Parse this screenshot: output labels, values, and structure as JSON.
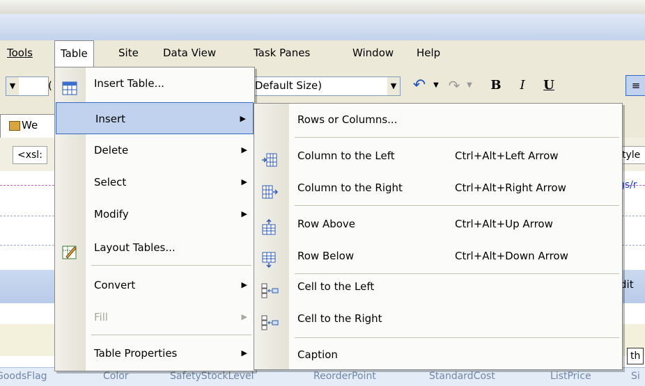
{
  "menubar": {
    "items": [
      {
        "label": "Tools",
        "mnemonic_index": 0
      },
      {
        "label": "Table",
        "mnemonic_index": 1
      },
      {
        "label": "Site",
        "mnemonic_index": 0
      },
      {
        "label": "Data View",
        "mnemonic_index": 0
      },
      {
        "label": "Task Panes",
        "mnemonic_index": 3
      },
      {
        "label": "Window",
        "mnemonic_index": 0
      },
      {
        "label": "Help",
        "mnemonic_index": 0
      }
    ]
  },
  "toolbar": {
    "font_size_value": "(Default Size)",
    "left_dropdown_fragment": "(",
    "bold_label": "B",
    "italic_label": "I",
    "underline_label": "U"
  },
  "background": {
    "tab_fragment": "We",
    "path_fragment": "<xsl:",
    "right_fragment_1": "tyle",
    "right_fragment_2": "gs/r",
    "right_fragment_3": "dit",
    "right_fragment_4": "th",
    "columns": [
      "GoodsFlag",
      "Color",
      "SafetyStockLevel",
      "ReorderPoint",
      "StandardCost",
      "ListPrice",
      "Si"
    ]
  },
  "table_menu": {
    "items": [
      {
        "label": "Insert Table...",
        "icon": "insert-table-icon",
        "submenu": false
      },
      {
        "label": "Insert",
        "submenu": true,
        "highlighted": true
      },
      {
        "label": "Delete",
        "submenu": true
      },
      {
        "label": "Select",
        "submenu": true
      },
      {
        "label": "Modify",
        "submenu": true
      },
      {
        "label": "Layout Tables...",
        "icon": "layout-tables-icon",
        "submenu": false
      },
      {
        "label": "Convert",
        "submenu": true
      },
      {
        "label": "Fill",
        "submenu": true,
        "disabled": true
      },
      {
        "label": "Table Properties",
        "submenu": true
      }
    ]
  },
  "insert_submenu": {
    "items": [
      {
        "label": "Rows or Columns...",
        "shortcut": ""
      },
      {
        "label": "Column to the Left",
        "shortcut": "Ctrl+Alt+Left Arrow",
        "icon": "column-left-icon"
      },
      {
        "label": "Column to the Right",
        "shortcut": "Ctrl+Alt+Right Arrow",
        "icon": "column-right-icon"
      },
      {
        "label": "Row Above",
        "shortcut": "Ctrl+Alt+Up Arrow",
        "icon": "row-above-icon"
      },
      {
        "label": "Row Below",
        "shortcut": "Ctrl+Alt+Down Arrow",
        "icon": "row-below-icon"
      },
      {
        "label": "Cell to the Left",
        "shortcut": "",
        "icon": "cell-left-icon"
      },
      {
        "label": "Cell to the Right",
        "shortcut": "",
        "icon": "cell-right-icon"
      },
      {
        "label": "Caption",
        "shortcut": ""
      }
    ]
  },
  "colors": {
    "highlight": "#c1d2ee",
    "highlight_border": "#316ac5",
    "menubar": "#ece9d8"
  }
}
